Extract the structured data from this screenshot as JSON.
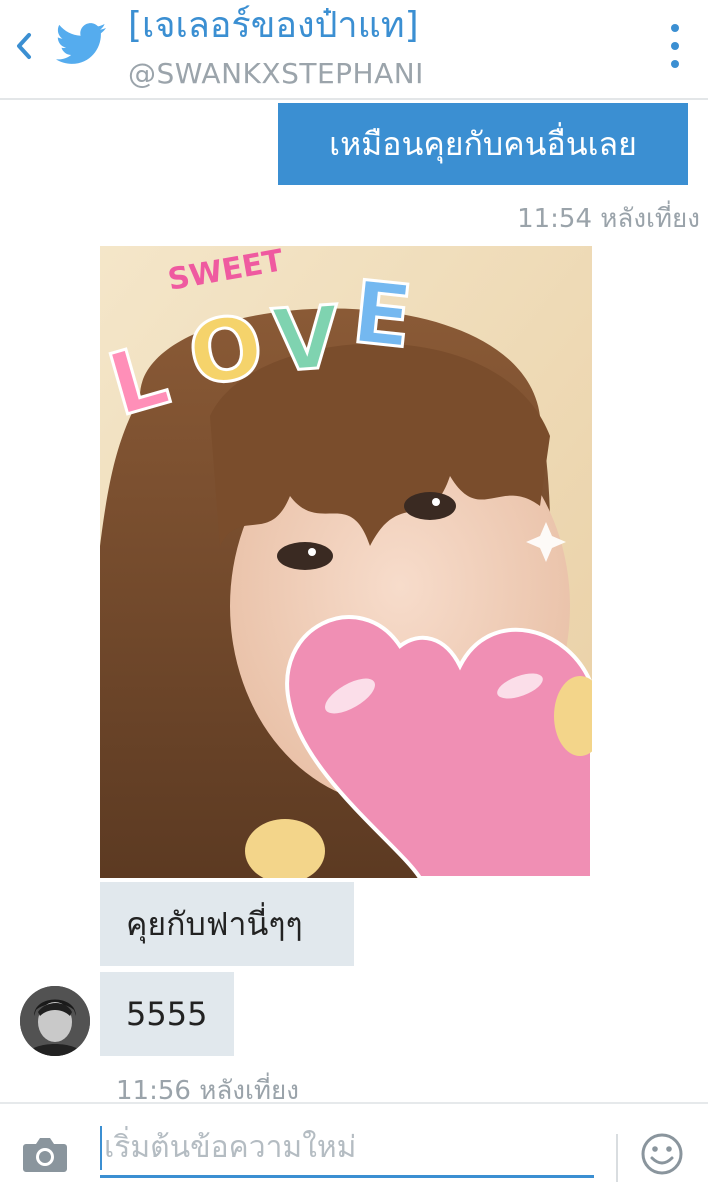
{
  "header": {
    "title": "[เจเลอร์ของป๋าแท]",
    "handle": "@SWANKXSTEPHANI"
  },
  "messages": {
    "sent": {
      "text": "เหมือนคุยกับคนอื่นเลย",
      "time": "11:54",
      "period": "หลังเที่ยง"
    },
    "photo": {
      "sticker_text": "SWEET LOVE"
    },
    "received": [
      {
        "text": "คุยกับฟานี่ๆๆ"
      },
      {
        "text": "5555"
      }
    ],
    "received_time": "11:56",
    "received_period": "หลังเที่ยง"
  },
  "composer": {
    "placeholder": "เริ่มต้นข้อความใหม่"
  },
  "colors": {
    "accent": "#3b8fd2",
    "bubble_received": "#e1e8ed",
    "muted_text": "#9aa3aa"
  },
  "icons": {
    "back": "chevron-left-icon",
    "logo": "twitter-bird-icon",
    "menu": "more-vertical-icon",
    "camera": "camera-icon",
    "emoji": "smiley-icon"
  }
}
